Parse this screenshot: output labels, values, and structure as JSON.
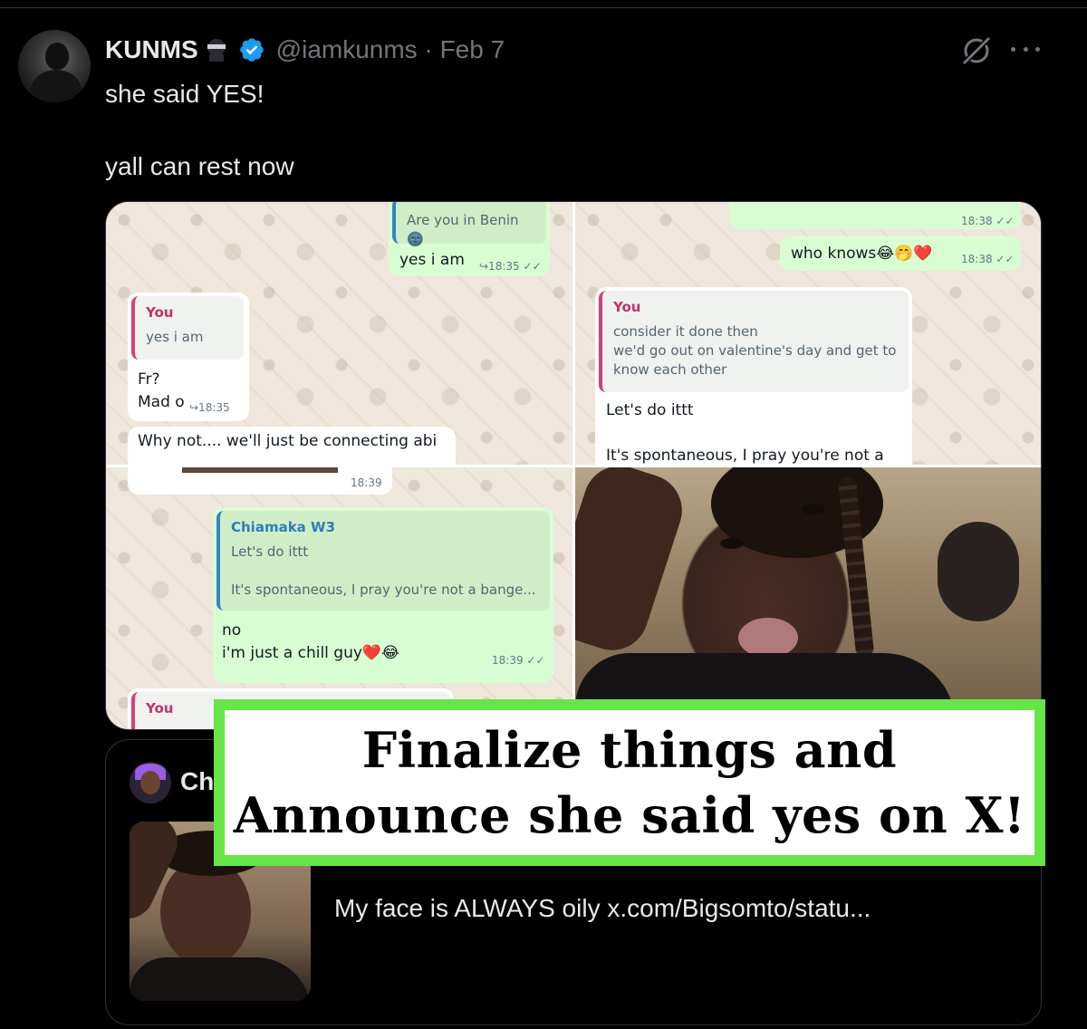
{
  "tweet": {
    "display_name": "KUNMS",
    "handle": "@iamkunms · Feb 7",
    "text_line1": "she said YES!",
    "text_line2": "yall can rest now"
  },
  "icons": {
    "badge": "ninja-emoji-icon",
    "verified": "verified-badge-icon",
    "grok": "grok-icon",
    "more": "more-icon"
  },
  "chat1": {
    "out_quote": "Are you in Benin🌚",
    "out_msg": "yes i am",
    "out_ts": "↪18:35 ✓✓",
    "in_quote_name": "You",
    "in_quote_text": "yes i am",
    "in_msg1": "Fr?",
    "in_msg2": "Mad o",
    "in_ts": "↪18:35",
    "in_msg3": "Why not.... we'll just be connecting abi"
  },
  "chat2": {
    "top_ts": "18:38 ✓✓",
    "out_msg": "who knows😂🤭❤️",
    "out_ts": "18:38 ✓✓",
    "quote_name": "You",
    "quote_l1": "consider it done then",
    "quote_l2": "we'd go out on valentine's day and get to",
    "quote_l3": "know each other",
    "msg1": "Let's do ittt",
    "msg2": "It's spontaneous, I pray you're not a"
  },
  "chat3": {
    "top_ts": "18:39",
    "quote_name": "Chiamaka W3",
    "quote_l1": "Let's do ittt",
    "quote_l2": "It's spontaneous, I pray you're not a bange...",
    "msg1": "no",
    "msg2": "i'm just a chill guy❤️😂",
    "ts": "18:39 ✓✓",
    "bottom_quote_name": "You"
  },
  "quoted": {
    "name": "Ch",
    "text": "My face is ALWAYS oily  x.com/Bigsomto/statu..."
  },
  "overlay": {
    "line1": "Finalize things and",
    "line2": "Announce she said yes on X!",
    "border_color": "#65e646"
  },
  "colors": {
    "background": "#000000",
    "muted": "#71767b",
    "verified": "#1d9bf0",
    "wa_out": "#d9fdd3"
  }
}
